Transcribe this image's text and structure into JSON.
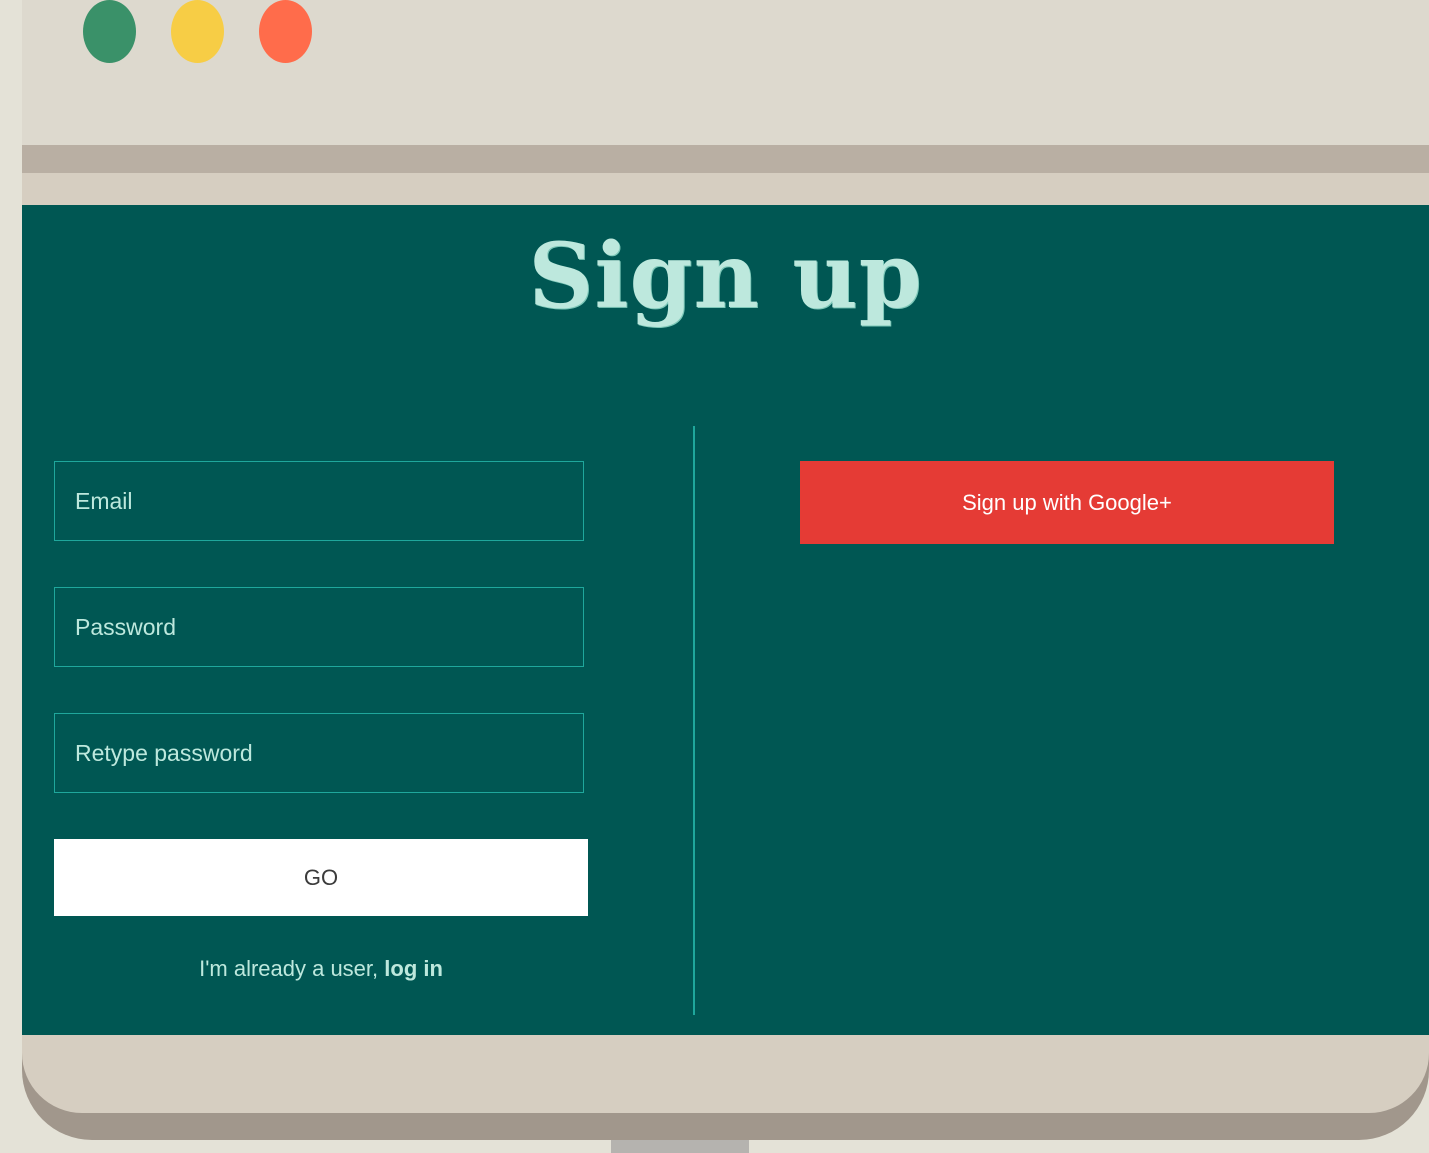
{
  "window_controls": {
    "close_color": "#3a9169",
    "minimize_color": "#f7cd45",
    "maximize_color": "#ff6c4b"
  },
  "page": {
    "title": "Sign up"
  },
  "form": {
    "email_placeholder": "Email",
    "password_placeholder": "Password",
    "retype_placeholder": "Retype password",
    "submit_label": "GO",
    "login_prompt": "I'm already a user, ",
    "login_link": "log in"
  },
  "social": {
    "google_label": "Sign up with Google+"
  },
  "colors": {
    "screen_bg": "#005753",
    "accent_border": "#1fa79c",
    "text_light": "#bde8dd",
    "google_red": "#e53b35"
  }
}
